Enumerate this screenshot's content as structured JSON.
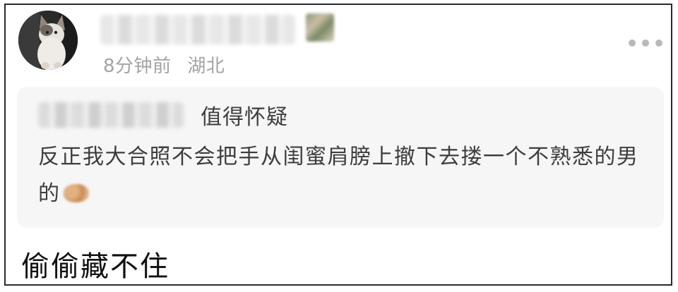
{
  "post": {
    "meta": {
      "time": "8分钟前",
      "location": "湖北"
    },
    "quote": {
      "title": "值得怀疑",
      "body": "反正我大合照不会把手从闺蜜肩膀上撤下去搂一个不熟悉的男的"
    },
    "content": "偷偷藏不住"
  },
  "icons": {
    "more": "more-horizontal-icon",
    "avatar": "cat-avatar"
  },
  "colors": {
    "meta_text": "#a3a3a3",
    "quote_bg": "#f6f6f6",
    "body_text": "#3d3d3d",
    "main_text": "#111111"
  }
}
